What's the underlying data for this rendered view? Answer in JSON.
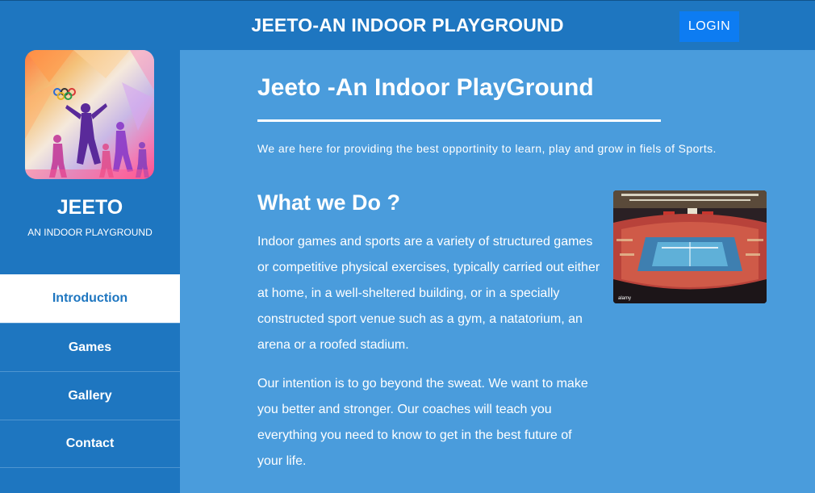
{
  "header": {
    "title": "JEETO-AN INDOOR PLAYGROUND",
    "login_label": "LOGIN"
  },
  "sidebar": {
    "brand_name": "JEETO",
    "brand_subtitle": "AN INDOOR PLAYGROUND",
    "nav": [
      {
        "label": "Introduction",
        "active": true
      },
      {
        "label": "Games",
        "active": false
      },
      {
        "label": "Gallery",
        "active": false
      },
      {
        "label": "Contact",
        "active": false
      }
    ]
  },
  "main": {
    "title": "Jeeto -An Indoor PlayGround",
    "tagline": "We are here for providing the best opportinity to learn, play and grow in fiels of Sports.",
    "section_heading": "What we Do ?",
    "paragraphs": [
      "Indoor games and sports are a variety of structured games or competitive physical exercises, typically carried out either at home, in a well-sheltered building, or in a specially constructed sport venue such as a gym, a natatorium, an arena or a roofed stadium.",
      "Our intention is to go beyond the sweat. We want to make you better and stronger. Our coaches will teach you everything you need to know to get in the best future of your life."
    ],
    "photo_watermark": "alamy"
  },
  "colors": {
    "header_bg": "#1e76c0",
    "main_bg": "#4a9cdc",
    "login_bg": "#0d7cf2",
    "active_nav_text": "#1e76c0"
  }
}
